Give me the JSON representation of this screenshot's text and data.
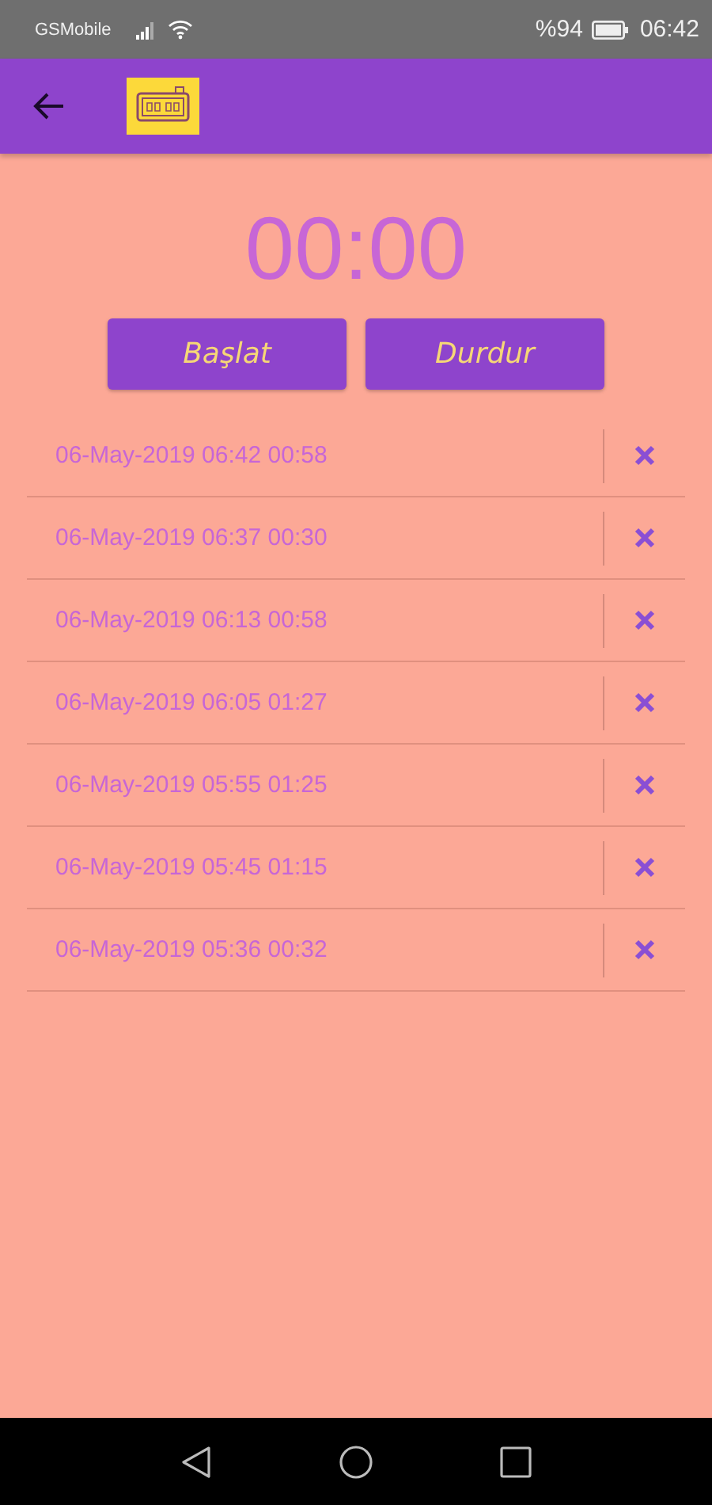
{
  "status_bar": {
    "carrier": "GSMobile",
    "battery": "%94",
    "time": "06:42"
  },
  "timer": {
    "display": "00:00"
  },
  "buttons": [
    {
      "label": "Başlat"
    },
    {
      "label": "Durdur"
    }
  ],
  "laps": [
    {
      "text": "06-May-2019 06:42 00:58"
    },
    {
      "text": "06-May-2019 06:37 00:30"
    },
    {
      "text": "06-May-2019 06:13 00:58"
    },
    {
      "text": "06-May-2019 06:05 01:27"
    },
    {
      "text": "06-May-2019 05:55 01:25"
    },
    {
      "text": "06-May-2019 05:45 01:15"
    },
    {
      "text": "06-May-2019 05:36 00:32"
    }
  ]
}
